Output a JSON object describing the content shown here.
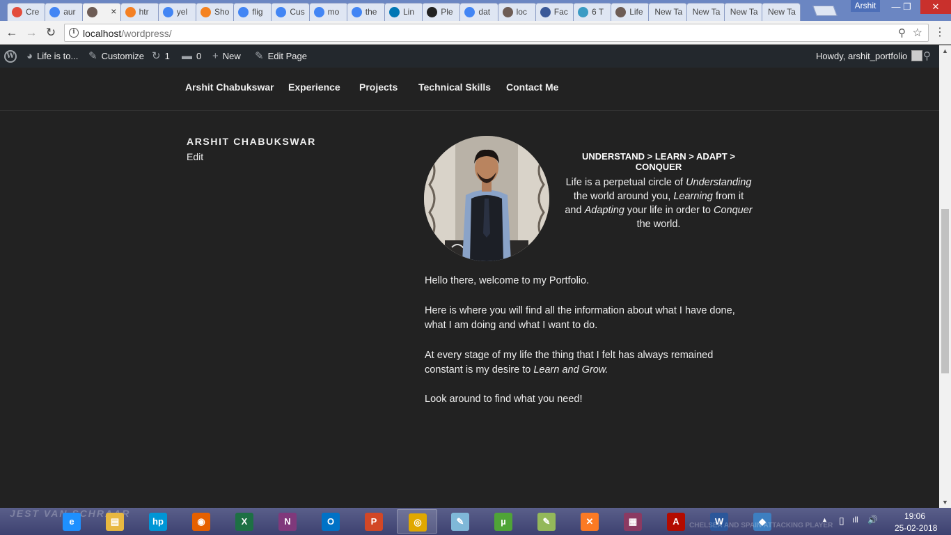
{
  "browser": {
    "tabs": [
      {
        "label": "Cre",
        "icon": "analytics-icon",
        "color": "#e34c3c"
      },
      {
        "label": "aur",
        "icon": "google-icon",
        "color": "#4285f4"
      },
      {
        "label": "",
        "icon": "page-thumb-icon",
        "color": "#6d5c55",
        "active": true
      },
      {
        "label": "htr",
        "icon": "stackoverflow-icon",
        "color": "#f48024"
      },
      {
        "label": "yel",
        "icon": "google-icon",
        "color": "#4285f4"
      },
      {
        "label": "Sho",
        "icon": "asterisk-icon",
        "color": "#f5821f"
      },
      {
        "label": "flig",
        "icon": "google-icon",
        "color": "#4285f4"
      },
      {
        "label": "Cus",
        "icon": "google-icon",
        "color": "#4285f4"
      },
      {
        "label": "mo",
        "icon": "google-icon",
        "color": "#4285f4"
      },
      {
        "label": "the",
        "icon": "google-icon",
        "color": "#4285f4"
      },
      {
        "label": "Lin",
        "icon": "linkedin-icon",
        "color": "#0077b5"
      },
      {
        "label": "Ple",
        "icon": "github-icon",
        "color": "#222222"
      },
      {
        "label": "dat",
        "icon": "google-icon",
        "color": "#4285f4"
      },
      {
        "label": "loc",
        "icon": "page-thumb-icon",
        "color": "#6d5c55"
      },
      {
        "label": "Fac",
        "icon": "facebook-icon",
        "color": "#3b5998"
      },
      {
        "label": "6 T",
        "icon": "medium-icon",
        "color": "#3a9bc4"
      },
      {
        "label": "Life",
        "icon": "page-thumb-icon",
        "color": "#6d5c55"
      },
      {
        "label": "New Ta",
        "icon": "",
        "color": ""
      },
      {
        "label": "New Ta",
        "icon": "",
        "color": ""
      },
      {
        "label": "New Ta",
        "icon": "",
        "color": ""
      },
      {
        "label": "New Ta",
        "icon": "",
        "color": ""
      }
    ],
    "tab_close": "×",
    "profile_name": "Arshit",
    "window_controls": {
      "minimize": "—",
      "maximize": "❐",
      "close": "✕"
    },
    "nav": {
      "back": "←",
      "forward": "→",
      "reload": "↻"
    },
    "url_host": "localhost",
    "url_path": "/wordpress/",
    "info_glyph": "i",
    "zoom_glyph": "⚲",
    "star_glyph": "☆",
    "menu_glyph": "⋮"
  },
  "adminbar": {
    "site_name": "Life is to...",
    "customize": "Customize",
    "updates_count": "1",
    "comments_count": "0",
    "new_label": "New",
    "edit_page": "Edit Page",
    "howdy": "Howdy, arshit_portfolio",
    "wp_glyph": "W",
    "icons": {
      "site": "◕",
      "customize": "✎",
      "updates": "↻",
      "comments": "▬",
      "new": "+",
      "edit": "✎",
      "search": "⚲"
    }
  },
  "sitenav": {
    "items": [
      "Arshit Chabukswar",
      "Experience",
      "Projects",
      "Technical Skills",
      "Contact Me"
    ]
  },
  "page": {
    "title": "ARSHIT CHABUKSWAR",
    "edit_link": "Edit",
    "tagline": "UNDERSTAND > LEARN > ADAPT > CONQUER",
    "philosophy": {
      "t1": "Life is a perpetual circle of ",
      "e1": "Understanding",
      "t2": " the world around you, ",
      "e2": "Learning",
      "t3": " from it and ",
      "e3": "Adapting",
      "t4": " your life in order to ",
      "e4": "Conquer",
      "t5": " the world."
    },
    "p1": "Hello there, welcome to my Portfolio.",
    "p2": "Here is where you will find all the information about what I have done, what I am doing and what I want to do.",
    "p3_text": "At every stage of my life the thing that I felt has always remained constant is my desire to ",
    "p3_em": "Learn and Grow.",
    "p4": "Look around to find what you need!"
  },
  "taskbar": {
    "wallpaper_text": "JEST VAN SCHRAAR",
    "wallpaper_text2": "CHELSEA AND SPAIN ATTACKING PLAYER",
    "apps": [
      {
        "name": "ie",
        "glyph": "e",
        "color": "#1e90ff"
      },
      {
        "name": "explorer",
        "glyph": "▤",
        "color": "#e8b840"
      },
      {
        "name": "hp",
        "glyph": "hp",
        "color": "#0096d6"
      },
      {
        "name": "firefox",
        "glyph": "◉",
        "color": "#e66000"
      },
      {
        "name": "excel",
        "glyph": "X",
        "color": "#1d7044"
      },
      {
        "name": "onenote",
        "glyph": "N",
        "color": "#80397b"
      },
      {
        "name": "outlook",
        "glyph": "O",
        "color": "#0072c6"
      },
      {
        "name": "powerpoint",
        "glyph": "P",
        "color": "#d24726"
      },
      {
        "name": "chrome",
        "glyph": "◎",
        "color": "#e0a800",
        "running": true
      },
      {
        "name": "notepad",
        "glyph": "✎",
        "color": "#7fb8d8"
      },
      {
        "name": "utorrent",
        "glyph": "µ",
        "color": "#4fa437"
      },
      {
        "name": "notepad++",
        "glyph": "✎",
        "color": "#93b85a"
      },
      {
        "name": "xampp",
        "glyph": "✕",
        "color": "#fb7a24"
      },
      {
        "name": "winrar",
        "glyph": "▦",
        "color": "#8b3a62"
      },
      {
        "name": "acrobat",
        "glyph": "A",
        "color": "#b30b00"
      },
      {
        "name": "word",
        "glyph": "W",
        "color": "#2b579a"
      },
      {
        "name": "virtualbox",
        "glyph": "◆",
        "color": "#3d7fc1"
      }
    ],
    "tray": {
      "chevron": "▲",
      "battery": "▯",
      "signal": "ıll",
      "volume": "🔊"
    },
    "time": "19:06",
    "date": "25-02-2018"
  }
}
